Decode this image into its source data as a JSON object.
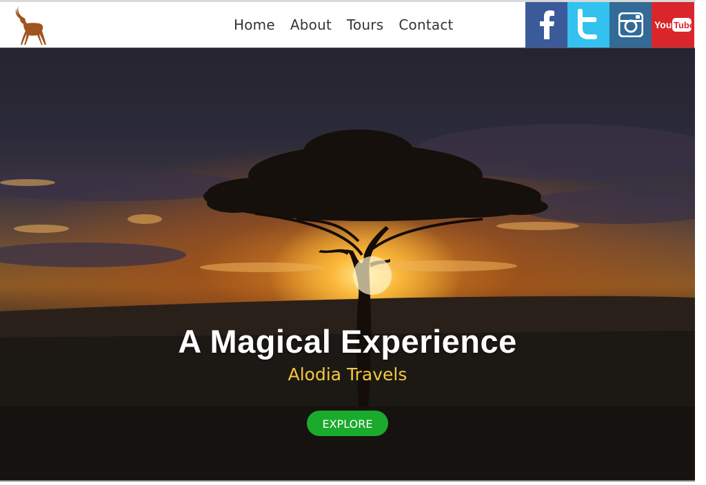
{
  "nav": {
    "items": [
      {
        "label": "Home"
      },
      {
        "label": "About"
      },
      {
        "label": "Tours"
      },
      {
        "label": "Contact"
      }
    ]
  },
  "social": {
    "facebook": {
      "icon": "facebook-icon",
      "color": "#3b5a99"
    },
    "twitter": {
      "icon": "twitter-icon",
      "color": "#33c2ef"
    },
    "instagram": {
      "icon": "instagram-icon",
      "color": "#336a98"
    },
    "youtube": {
      "icon": "youtube-icon",
      "color": "#d9262a",
      "label": "YouTube"
    }
  },
  "hero": {
    "title": "A Magical Experience",
    "subtitle": "Alodia Travels",
    "cta": "EXPLORE"
  },
  "colors": {
    "accent_green": "#1aaa2c",
    "subtitle_gold": "#f4c93c",
    "logo_brown": "#a0522d"
  }
}
